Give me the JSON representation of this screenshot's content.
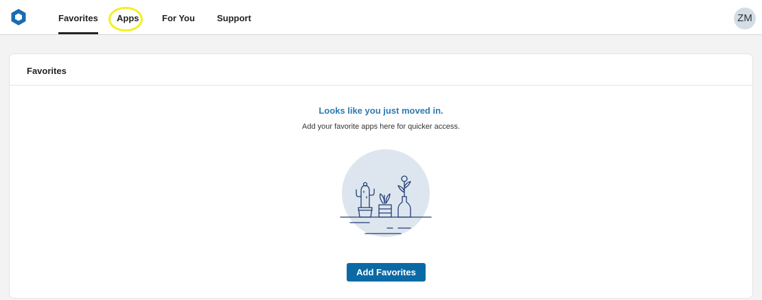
{
  "nav": {
    "tabs": [
      {
        "label": "Favorites",
        "active": true
      },
      {
        "label": "Apps",
        "active": false
      },
      {
        "label": "For You",
        "active": false
      },
      {
        "label": "Support",
        "active": false
      }
    ],
    "avatar_initials": "ZM"
  },
  "favorites_card": {
    "title": "Favorites",
    "empty_heading": "Looks like you just moved in.",
    "empty_message": "Add your favorite apps here for quicker access.",
    "add_button_label": "Add Favorites"
  },
  "icons": {
    "logo": "hexagon-logo-icon",
    "illustration": "plants-on-shelf-illustration"
  },
  "colors": {
    "accent_blue": "#2b7ab3",
    "button_blue": "#0b6aa6",
    "illustration_stroke": "#1f3b73",
    "illustration_circle": "#dde6ee",
    "highlight_yellow": "#f4ef1f"
  }
}
